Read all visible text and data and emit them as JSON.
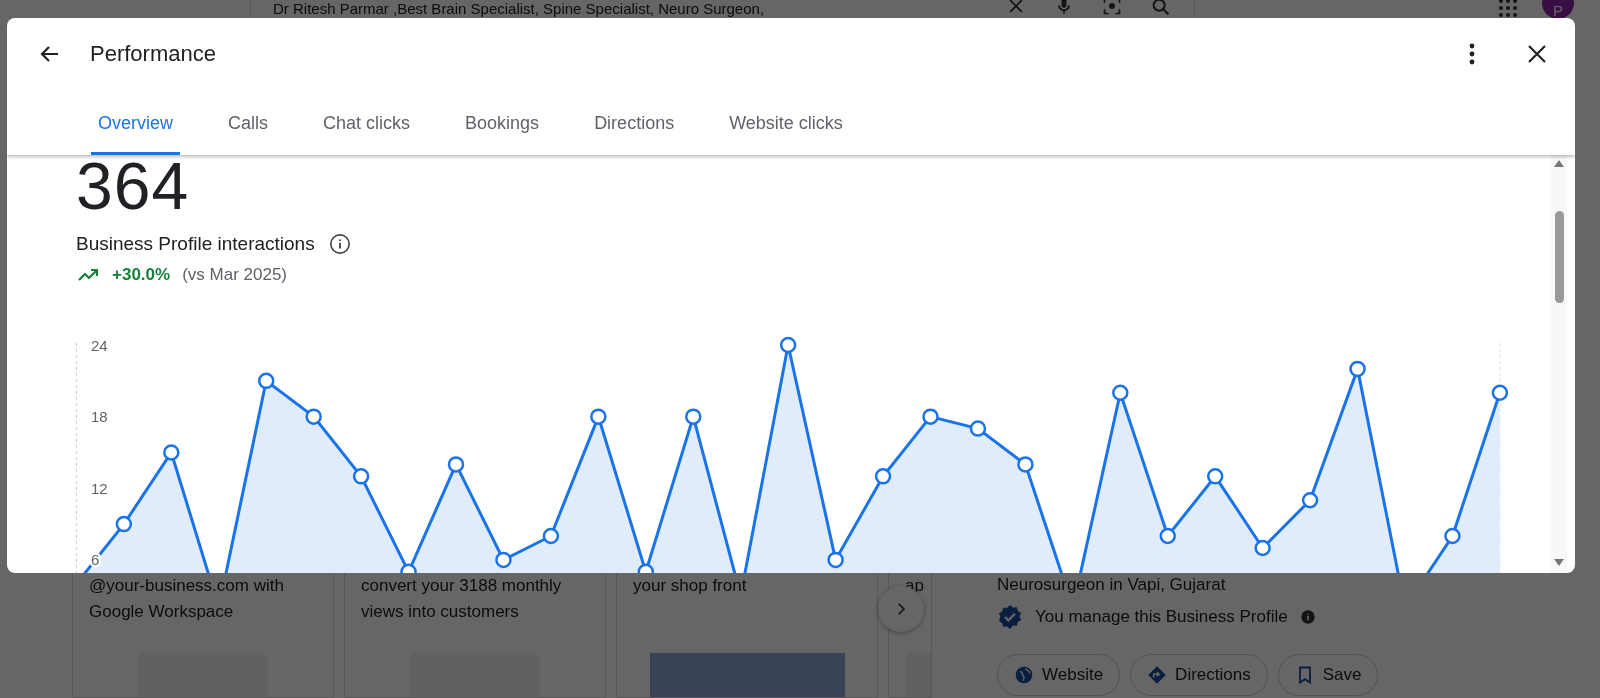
{
  "background_page": {
    "search_query": "Dr Ritesh Parmar ,Best Brain Specialist, Spine Specialist, Neuro Surgeon,",
    "account_initial": "P",
    "cards": [
      {
        "text": "@your-business.com with Google Workspace"
      },
      {
        "text": "convert your 3188 monthly views into customers"
      },
      {
        "text": "your shop front"
      },
      {
        "text": "ap"
      }
    ],
    "profile": {
      "category": "Neurosurgeon in Vapi, Gujarat",
      "managed_note": "You manage this Business Profile",
      "actions": [
        {
          "kind": "website",
          "label": "Website"
        },
        {
          "kind": "directions",
          "label": "Directions"
        },
        {
          "kind": "save",
          "label": "Save"
        }
      ]
    }
  },
  "dialog": {
    "title": "Performance",
    "tabs": [
      {
        "label": "Overview",
        "selected": true
      },
      {
        "label": "Calls",
        "selected": false
      },
      {
        "label": "Chat clicks",
        "selected": false
      },
      {
        "label": "Bookings",
        "selected": false
      },
      {
        "label": "Directions",
        "selected": false
      },
      {
        "label": "Website clicks",
        "selected": false
      }
    ],
    "total": "364",
    "metric_label": "Business Profile interactions",
    "change": "+30.0%",
    "comparison": "(vs Mar 2025)",
    "chart_data": {
      "type": "area",
      "categories": [
        null,
        null,
        null,
        null,
        null,
        null,
        null,
        null,
        null,
        null,
        null,
        null,
        null,
        null,
        null,
        null,
        null,
        null,
        null,
        null,
        null,
        null,
        null,
        null,
        null,
        null,
        null,
        null,
        null,
        null,
        null
      ],
      "yticks": [
        6,
        12,
        18,
        24
      ],
      "ylim": [
        0,
        24
      ],
      "series": [
        {
          "color": "#1a73e8",
          "values": [
            4,
            9,
            15,
            2,
            21,
            18,
            13,
            5,
            14,
            6,
            8,
            18,
            5,
            18,
            3,
            24,
            6,
            13,
            18,
            17,
            14,
            2,
            20,
            8,
            13,
            7,
            11,
            22,
            2,
            8,
            20
          ]
        }
      ]
    }
  }
}
